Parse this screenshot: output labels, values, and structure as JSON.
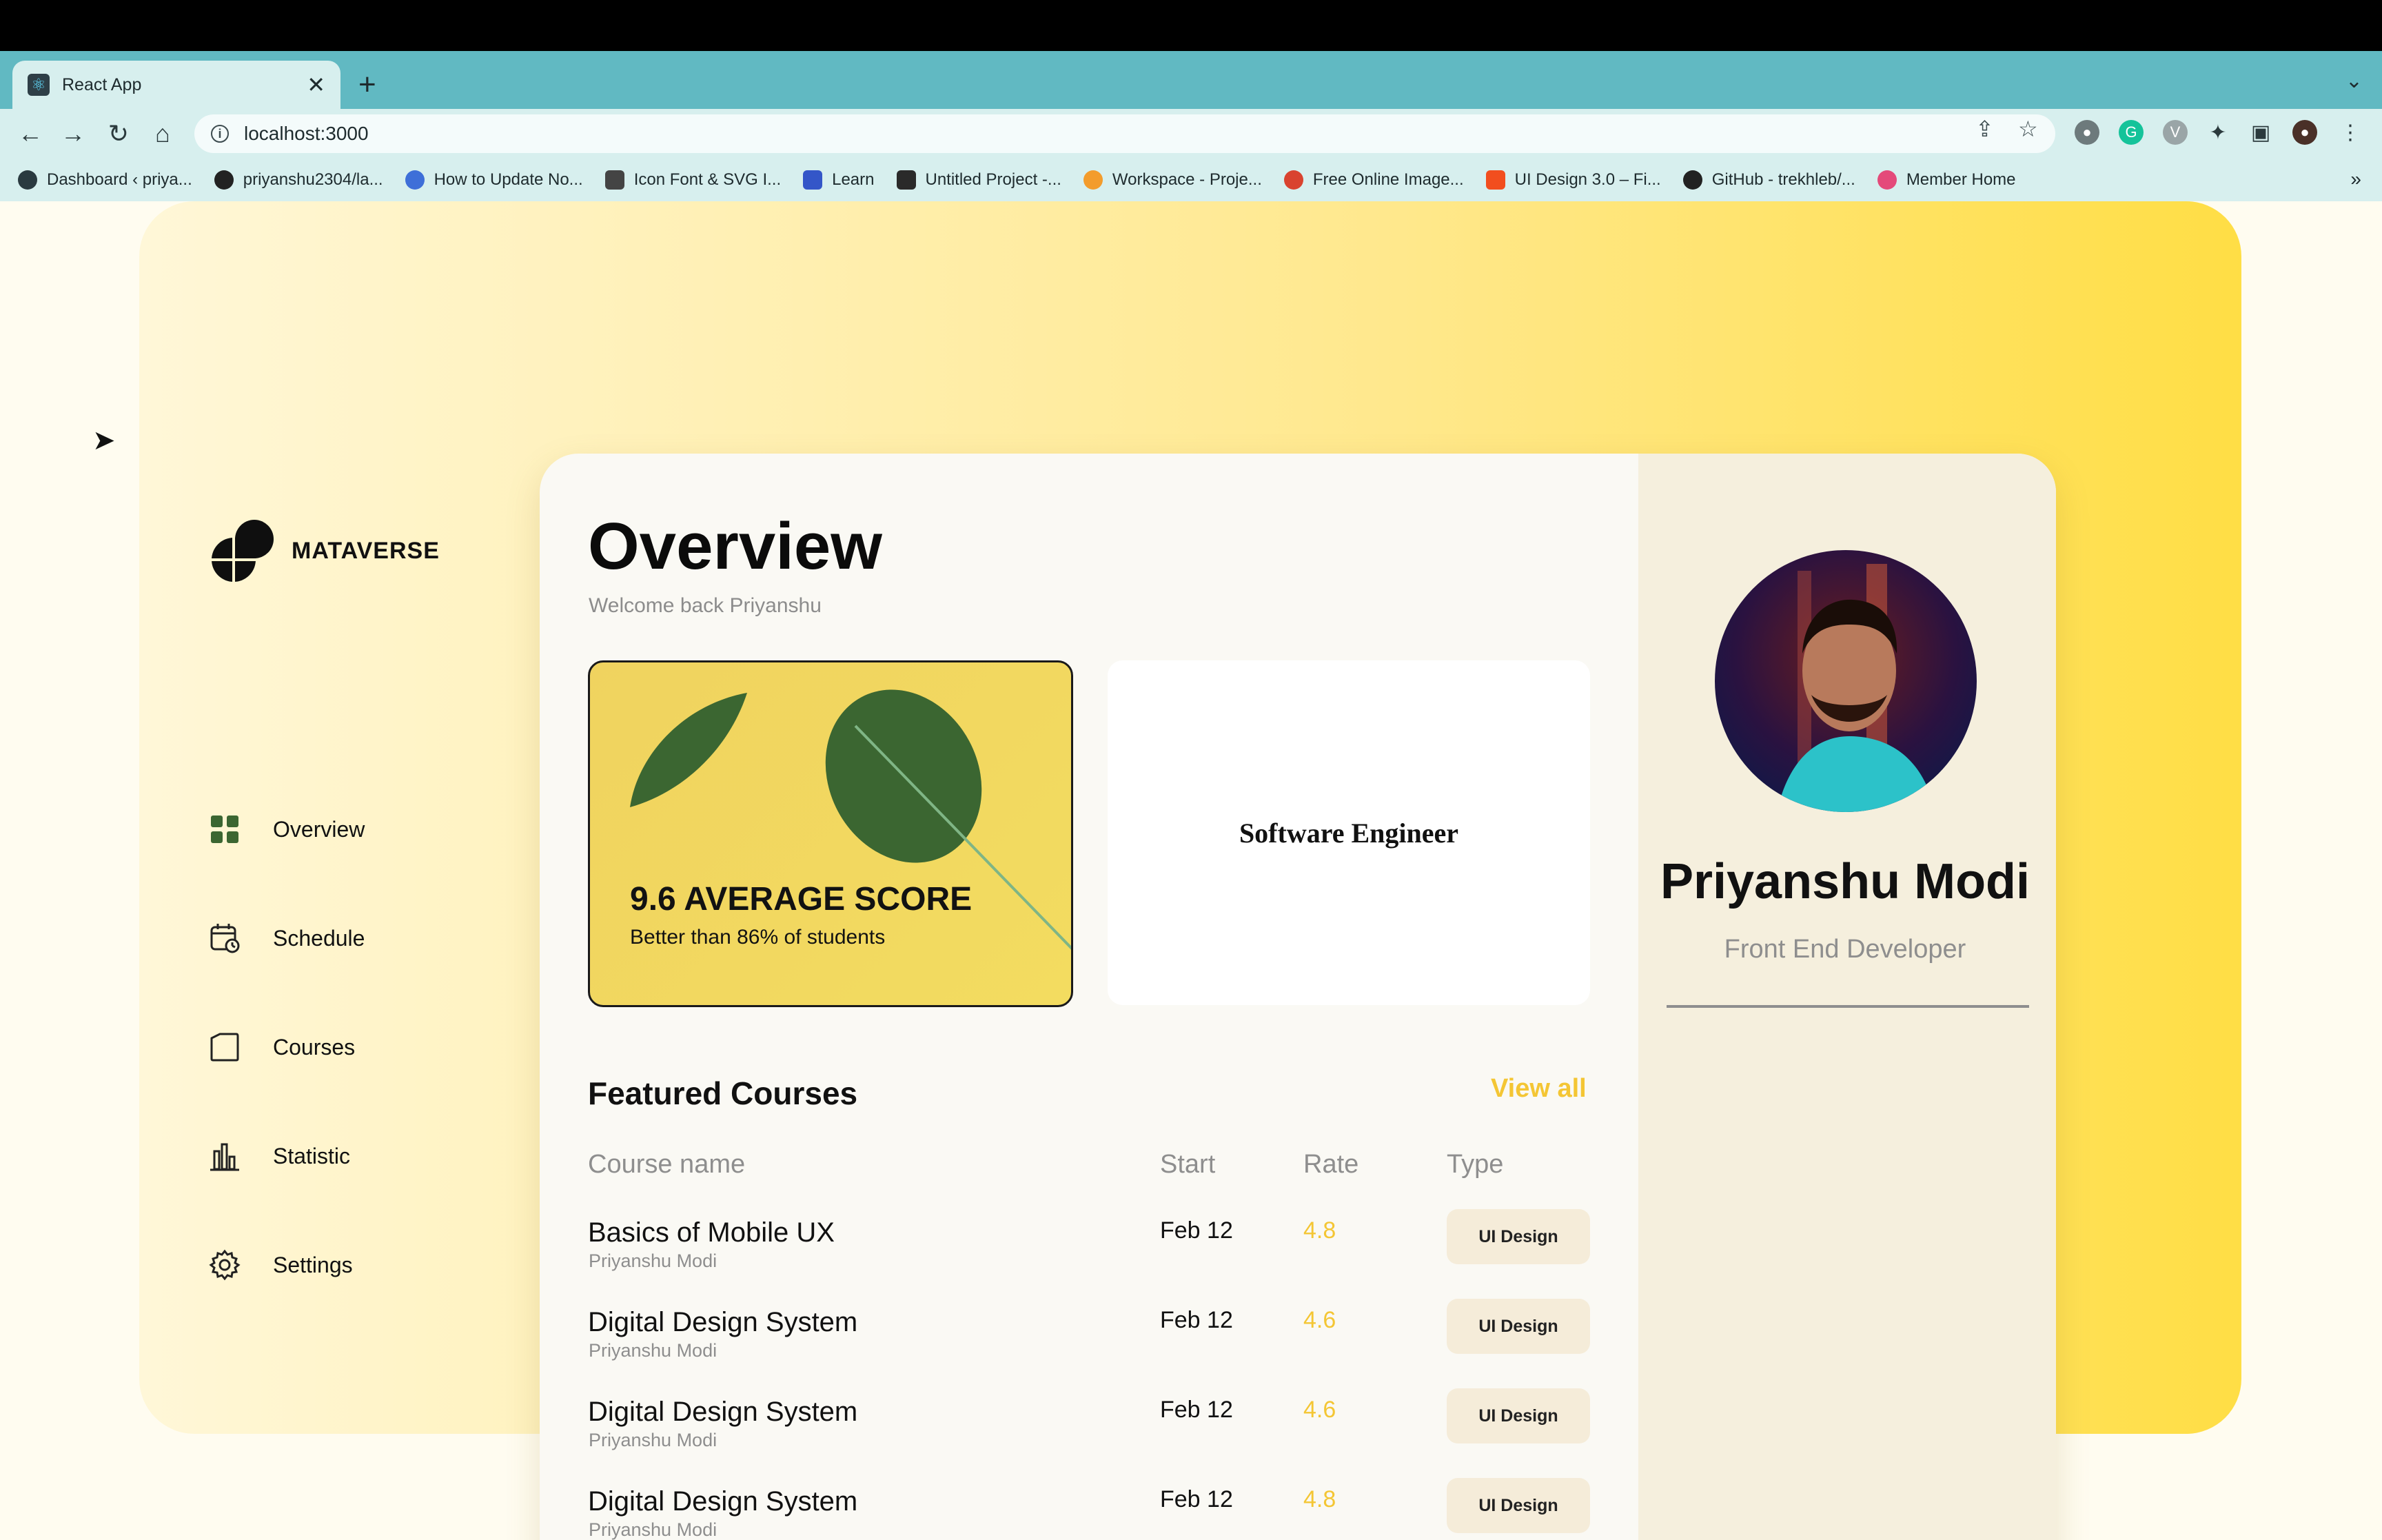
{
  "browser": {
    "tab_title": "React App",
    "url": "localhost:3000",
    "bookmarks": [
      {
        "label": "Dashboard ‹ priya...",
        "color": "#2a3a40"
      },
      {
        "label": "priyanshu2304/la...",
        "color": "#222222"
      },
      {
        "label": "How to Update No...",
        "color": "#3e6fd8"
      },
      {
        "label": "Icon Font & SVG I...",
        "color": "#444444"
      },
      {
        "label": "Learn",
        "color": "#3456c8"
      },
      {
        "label": "Untitled Project -...",
        "color": "#2a2a2a"
      },
      {
        "label": "Workspace - Proje...",
        "color": "#f39c2c"
      },
      {
        "label": "Free Online Image...",
        "color": "#d9432f"
      },
      {
        "label": "UI Design 3.0 – Fi...",
        "color": "#f24e1e"
      },
      {
        "label": "GitHub - trekhleb/...",
        "color": "#222222"
      },
      {
        "label": "Member Home",
        "color": "#e44a7a"
      }
    ]
  },
  "sidebar": {
    "brand": "MATAVERSE",
    "items": [
      {
        "label": "Overview",
        "icon": "grid-icon"
      },
      {
        "label": "Schedule",
        "icon": "calendar-icon"
      },
      {
        "label": "Courses",
        "icon": "folder-icon"
      },
      {
        "label": "Statistic",
        "icon": "bar-chart-icon"
      },
      {
        "label": "Settings",
        "icon": "gear-icon"
      }
    ],
    "active_color": "#3b6631"
  },
  "main": {
    "title": "Overview",
    "welcome": "Welcome back Priyanshu",
    "score": {
      "title": "9.6 AVERAGE SCORE",
      "subtitle": "Better than 86% of students"
    },
    "role_card": "Software Engineer",
    "featured": {
      "title": "Featured Courses",
      "view_all": "View all",
      "headers": {
        "name": "Course name",
        "start": "Start",
        "rate": "Rate",
        "type": "Type"
      },
      "rows": [
        {
          "name": "Basics of Mobile UX",
          "author": "Priyanshu Modi",
          "start": "Feb 12",
          "rate": "4.8",
          "type": "UI Design"
        },
        {
          "name": "Digital Design System",
          "author": "Priyanshu Modi",
          "start": "Feb 12",
          "rate": "4.6",
          "type": "UI Design"
        },
        {
          "name": "Digital Design System",
          "author": "Priyanshu Modi",
          "start": "Feb 12",
          "rate": "4.6",
          "type": "UI Design"
        },
        {
          "name": "Digital Design System",
          "author": "Priyanshu Modi",
          "start": "Feb 12",
          "rate": "4.8",
          "type": "UI Design"
        }
      ]
    }
  },
  "profile": {
    "name": "Priyanshu Modi",
    "role": "Front End Developer"
  },
  "colors": {
    "accent_yellow": "#f4c634",
    "leaf_green": "#3b6631"
  }
}
